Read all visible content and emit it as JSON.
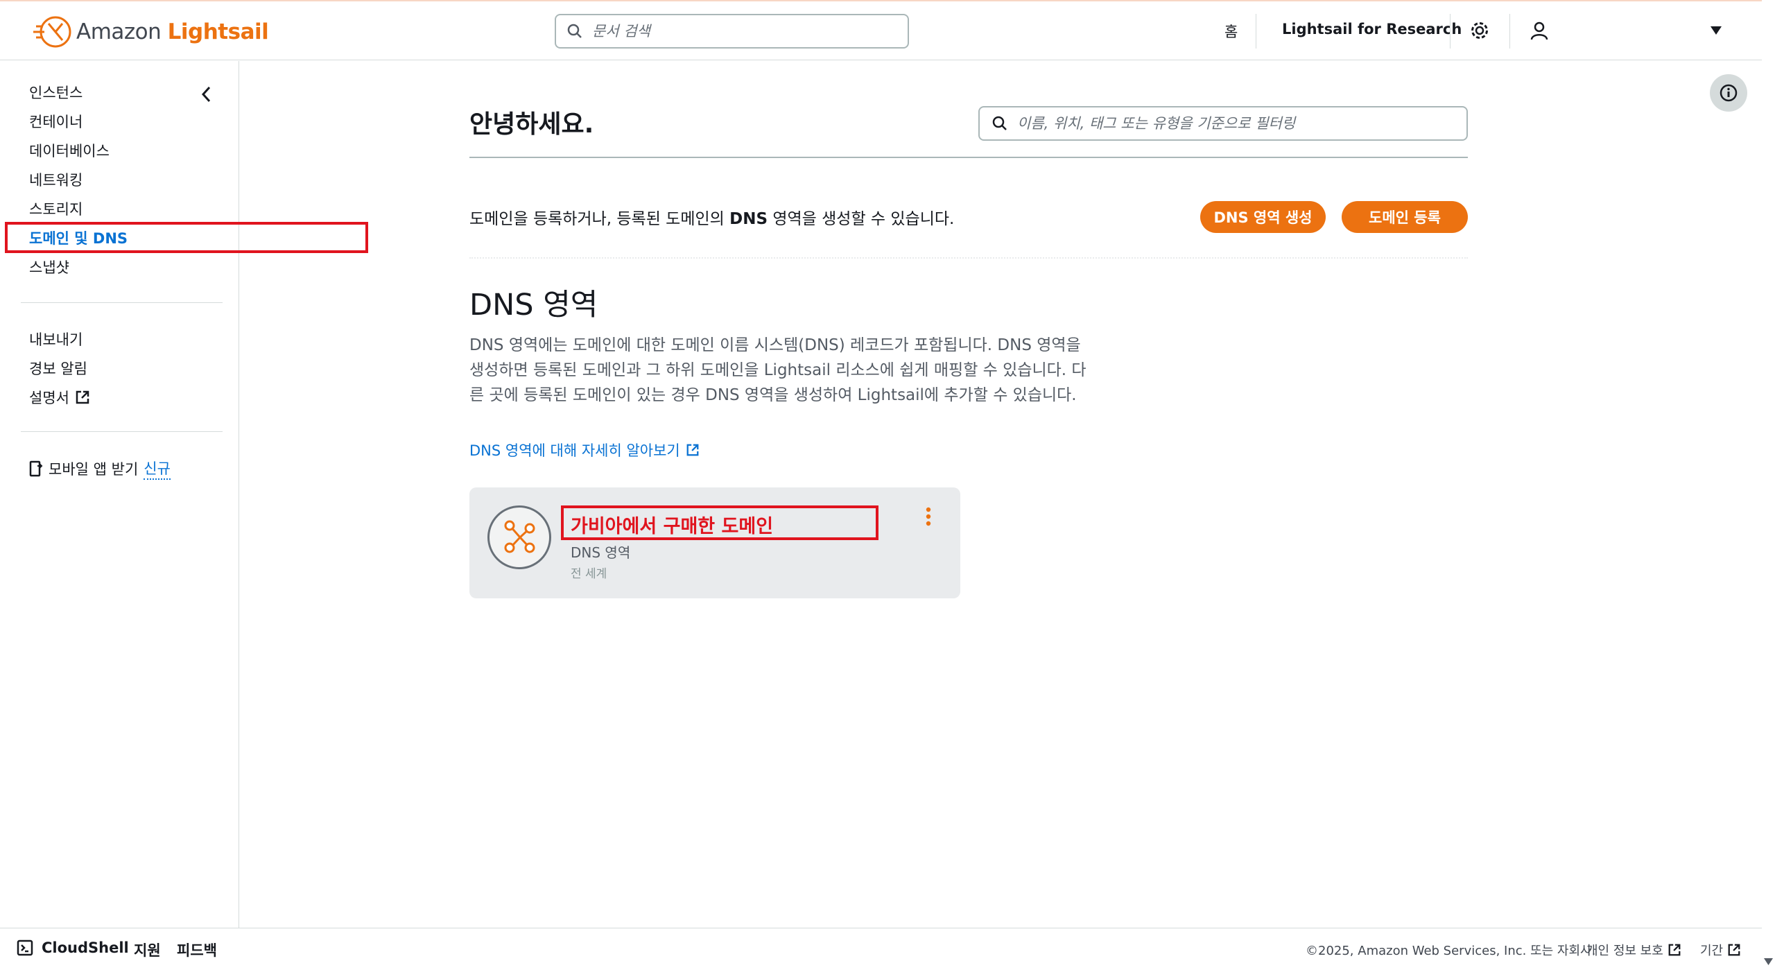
{
  "header": {
    "logo_amazon": "Amazon",
    "logo_lightsail": "Lightsail",
    "doc_search_placeholder": "문서 검색",
    "home": "홈",
    "research": "Lightsail for Research"
  },
  "sidebar": {
    "items": [
      {
        "label": "인스턴스"
      },
      {
        "label": "컨테이너"
      },
      {
        "label": "데이터베이스"
      },
      {
        "label": "네트워킹"
      },
      {
        "label": "스토리지"
      },
      {
        "label": "도메인 및 DNS"
      },
      {
        "label": "스냅샷"
      }
    ],
    "items2": [
      {
        "label": "내보내기"
      },
      {
        "label": "경보 알림"
      },
      {
        "label": "설명서"
      }
    ],
    "mobile_app": "모바일 앱 받기",
    "new_badge": "신규"
  },
  "main": {
    "greeting": "안녕하세요.",
    "filter_placeholder": "이름, 위치, 태그 또는 유형을 기준으로 필터링",
    "intro_pre": "도메인을 등록하거나, 등록된 도메인의 ",
    "intro_bold": "DNS",
    "intro_post": " 영역을 생성할 수 있습니다.",
    "create_dns_button": "DNS 영역 생성",
    "register_domain_button": "도메인 등록",
    "section_title": "DNS 영역",
    "description": "DNS 영역에는 도메인에 대한 도메인 이름 시스템(DNS) 레코드가 포함됩니다. DNS 영역을 생성하면 등록된 도메인과 그 하위 도메인을 Lightsail 리소스에 쉽게 매핑할 수 있습니다. 다른 곳에 등록된 도메인이 있는 경우 DNS 영역을 생성하여 Lightsail에 추가할 수 있습니다.",
    "learn_more": "DNS 영역에 대해 자세히 알아보기",
    "card": {
      "title": "가비아에서 구매한 도메인",
      "type": "DNS 영역",
      "region": "전 세계"
    }
  },
  "footer": {
    "cloudshell": "CloudShell",
    "support": "지원",
    "feedback": "피드백",
    "copyright": "©2025, Amazon Web Services, Inc. 또는 자회사.",
    "privacy": "개인 정보 보호",
    "terms": "기간"
  },
  "colors": {
    "accent_orange": "#ec7211",
    "link_blue": "#0972d3",
    "annotation_red": "#e0141e"
  },
  "icons": [
    "search-icon",
    "settings-gear-icon",
    "user-icon",
    "caret-down-icon",
    "chevron-left-icon",
    "external-link-icon",
    "mobile-icon",
    "info-icon",
    "kebab-menu-icon",
    "dns-zone-icon",
    "terminal-icon"
  ]
}
